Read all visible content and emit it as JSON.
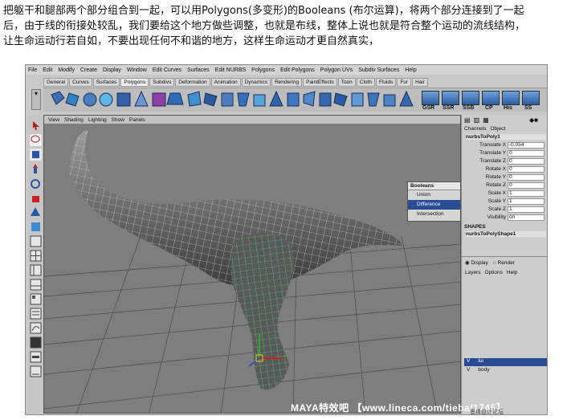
{
  "article": {
    "line1": "把躯干和腿部两个部分组合到一起，可以用Polygons(多变形)的Booleans (布尔运算)，将两个部分连接到了一起",
    "line2": "后，由于线的衔接处较乱，我们要给这个地方做些调整，也就是布线，整体上说也就是符合整个运动的流线结构，",
    "line3": "让生命运动行若自如，不要出现任何不和谐的地方，这样生命运动才更自然真实，"
  },
  "maya": {
    "menu": [
      "File",
      "Edit",
      "Modify",
      "Create",
      "Display",
      "Window",
      "Edit Curves",
      "Surfaces",
      "Edit NURBS",
      "Polygons",
      "Edit Polygons",
      "Polygon UVs",
      "Subdiv Surfaces",
      "Help"
    ],
    "shelf_tabs": [
      "General",
      "Curves",
      "Surfaces",
      "Polygons",
      "Subdivs",
      "Deformation",
      "Animation",
      "Dynamics",
      "Rendering",
      "PaintEffects",
      "Toon",
      "Cloth",
      "Fluids",
      "Fur",
      "Hair"
    ],
    "active_shelf_tab": "Polygons",
    "shelf_right_labels": [
      "GSR",
      "SSR",
      "SSB",
      "CP",
      "His",
      "SS"
    ],
    "viewport_menu": [
      "View",
      "Shading",
      "Lighting",
      "Show",
      "Panels"
    ],
    "booleans_menu": {
      "title": "Booleans",
      "items": [
        "Union",
        "Difference",
        "Intersection"
      ],
      "selected": "Difference"
    },
    "channel_box": {
      "tabs": [
        "Channels",
        "Object"
      ],
      "object_name": "nurbsToPoly1",
      "attributes": [
        {
          "label": "Translate X",
          "value": "-0.054"
        },
        {
          "label": "Translate Y",
          "value": "0"
        },
        {
          "label": "Translate Z",
          "value": "0"
        },
        {
          "label": "Rotate X",
          "value": "0"
        },
        {
          "label": "Rotate Y",
          "value": "0"
        },
        {
          "label": "Rotate Z",
          "value": "0"
        },
        {
          "label": "Scale X",
          "value": "1"
        },
        {
          "label": "Scale Y",
          "value": "1"
        },
        {
          "label": "Scale Z",
          "value": "1"
        },
        {
          "label": "Visibility",
          "value": "on"
        }
      ],
      "shapes_header": "SHAPES",
      "shape_name": "nurbsToPolyShape1"
    },
    "layer_editor": {
      "display_label": "Display",
      "render_label": "Render",
      "menu": [
        "Layers",
        "Options",
        "Help"
      ],
      "layers": [
        {
          "v": "V",
          "name": "lui"
        },
        {
          "v": "V",
          "name": "body"
        }
      ]
    },
    "watermark": "MAYA特效吧  【www.lineca.com/tieba/1745】",
    "watermark2": "思缘设计论坛 www.MISSVUAN.COM"
  }
}
